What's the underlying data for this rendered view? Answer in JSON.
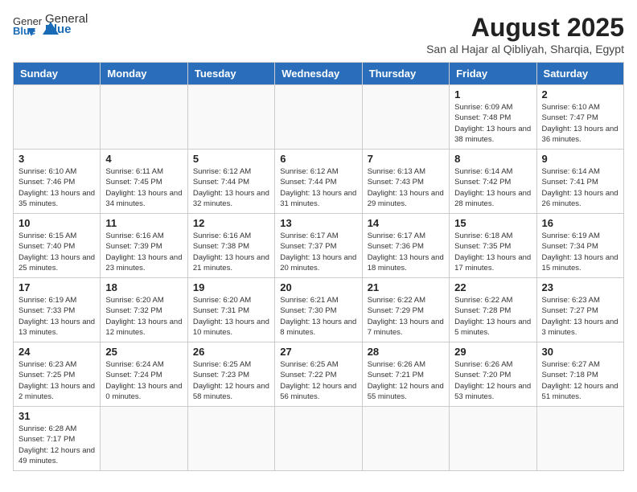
{
  "header": {
    "logo_general": "General",
    "logo_blue": "Blue",
    "month_year": "August 2025",
    "location": "San al Hajar al Qibliyah, Sharqia, Egypt"
  },
  "weekdays": [
    "Sunday",
    "Monday",
    "Tuesday",
    "Wednesday",
    "Thursday",
    "Friday",
    "Saturday"
  ],
  "weeks": [
    [
      {
        "day": "",
        "info": ""
      },
      {
        "day": "",
        "info": ""
      },
      {
        "day": "",
        "info": ""
      },
      {
        "day": "",
        "info": ""
      },
      {
        "day": "",
        "info": ""
      },
      {
        "day": "1",
        "info": "Sunrise: 6:09 AM\nSunset: 7:48 PM\nDaylight: 13 hours and 38 minutes."
      },
      {
        "day": "2",
        "info": "Sunrise: 6:10 AM\nSunset: 7:47 PM\nDaylight: 13 hours and 36 minutes."
      }
    ],
    [
      {
        "day": "3",
        "info": "Sunrise: 6:10 AM\nSunset: 7:46 PM\nDaylight: 13 hours and 35 minutes."
      },
      {
        "day": "4",
        "info": "Sunrise: 6:11 AM\nSunset: 7:45 PM\nDaylight: 13 hours and 34 minutes."
      },
      {
        "day": "5",
        "info": "Sunrise: 6:12 AM\nSunset: 7:44 PM\nDaylight: 13 hours and 32 minutes."
      },
      {
        "day": "6",
        "info": "Sunrise: 6:12 AM\nSunset: 7:44 PM\nDaylight: 13 hours and 31 minutes."
      },
      {
        "day": "7",
        "info": "Sunrise: 6:13 AM\nSunset: 7:43 PM\nDaylight: 13 hours and 29 minutes."
      },
      {
        "day": "8",
        "info": "Sunrise: 6:14 AM\nSunset: 7:42 PM\nDaylight: 13 hours and 28 minutes."
      },
      {
        "day": "9",
        "info": "Sunrise: 6:14 AM\nSunset: 7:41 PM\nDaylight: 13 hours and 26 minutes."
      }
    ],
    [
      {
        "day": "10",
        "info": "Sunrise: 6:15 AM\nSunset: 7:40 PM\nDaylight: 13 hours and 25 minutes."
      },
      {
        "day": "11",
        "info": "Sunrise: 6:16 AM\nSunset: 7:39 PM\nDaylight: 13 hours and 23 minutes."
      },
      {
        "day": "12",
        "info": "Sunrise: 6:16 AM\nSunset: 7:38 PM\nDaylight: 13 hours and 21 minutes."
      },
      {
        "day": "13",
        "info": "Sunrise: 6:17 AM\nSunset: 7:37 PM\nDaylight: 13 hours and 20 minutes."
      },
      {
        "day": "14",
        "info": "Sunrise: 6:17 AM\nSunset: 7:36 PM\nDaylight: 13 hours and 18 minutes."
      },
      {
        "day": "15",
        "info": "Sunrise: 6:18 AM\nSunset: 7:35 PM\nDaylight: 13 hours and 17 minutes."
      },
      {
        "day": "16",
        "info": "Sunrise: 6:19 AM\nSunset: 7:34 PM\nDaylight: 13 hours and 15 minutes."
      }
    ],
    [
      {
        "day": "17",
        "info": "Sunrise: 6:19 AM\nSunset: 7:33 PM\nDaylight: 13 hours and 13 minutes."
      },
      {
        "day": "18",
        "info": "Sunrise: 6:20 AM\nSunset: 7:32 PM\nDaylight: 13 hours and 12 minutes."
      },
      {
        "day": "19",
        "info": "Sunrise: 6:20 AM\nSunset: 7:31 PM\nDaylight: 13 hours and 10 minutes."
      },
      {
        "day": "20",
        "info": "Sunrise: 6:21 AM\nSunset: 7:30 PM\nDaylight: 13 hours and 8 minutes."
      },
      {
        "day": "21",
        "info": "Sunrise: 6:22 AM\nSunset: 7:29 PM\nDaylight: 13 hours and 7 minutes."
      },
      {
        "day": "22",
        "info": "Sunrise: 6:22 AM\nSunset: 7:28 PM\nDaylight: 13 hours and 5 minutes."
      },
      {
        "day": "23",
        "info": "Sunrise: 6:23 AM\nSunset: 7:27 PM\nDaylight: 13 hours and 3 minutes."
      }
    ],
    [
      {
        "day": "24",
        "info": "Sunrise: 6:23 AM\nSunset: 7:25 PM\nDaylight: 13 hours and 2 minutes."
      },
      {
        "day": "25",
        "info": "Sunrise: 6:24 AM\nSunset: 7:24 PM\nDaylight: 13 hours and 0 minutes."
      },
      {
        "day": "26",
        "info": "Sunrise: 6:25 AM\nSunset: 7:23 PM\nDaylight: 12 hours and 58 minutes."
      },
      {
        "day": "27",
        "info": "Sunrise: 6:25 AM\nSunset: 7:22 PM\nDaylight: 12 hours and 56 minutes."
      },
      {
        "day": "28",
        "info": "Sunrise: 6:26 AM\nSunset: 7:21 PM\nDaylight: 12 hours and 55 minutes."
      },
      {
        "day": "29",
        "info": "Sunrise: 6:26 AM\nSunset: 7:20 PM\nDaylight: 12 hours and 53 minutes."
      },
      {
        "day": "30",
        "info": "Sunrise: 6:27 AM\nSunset: 7:18 PM\nDaylight: 12 hours and 51 minutes."
      }
    ],
    [
      {
        "day": "31",
        "info": "Sunrise: 6:28 AM\nSunset: 7:17 PM\nDaylight: 12 hours and 49 minutes."
      },
      {
        "day": "",
        "info": ""
      },
      {
        "day": "",
        "info": ""
      },
      {
        "day": "",
        "info": ""
      },
      {
        "day": "",
        "info": ""
      },
      {
        "day": "",
        "info": ""
      },
      {
        "day": "",
        "info": ""
      }
    ]
  ]
}
